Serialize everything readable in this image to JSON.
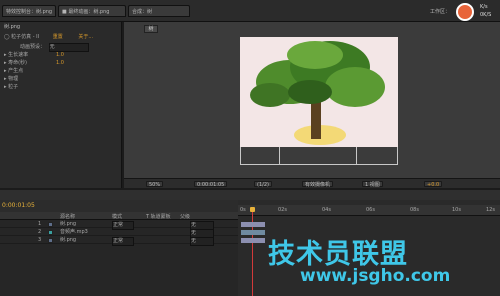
{
  "header": {
    "tab_effects": "特效控制台：树.png",
    "tab_source": "■ 最终动画：树.png",
    "tab_comp": "合成：树",
    "workspace_label": "工作区：",
    "comp_tab": "树",
    "right_fragments": [
      "K/s",
      "0K/S"
    ]
  },
  "left_panel": {
    "title": "树.png",
    "layer_name": "◯ 粒子仿真 - II",
    "reset": "重置",
    "about": "关于...",
    "preset_label": "动画预设：",
    "preset_value": "无",
    "rows": [
      {
        "label": "▸ 生长速率",
        "value": "1.0"
      },
      {
        "label": "▸ 寿命(秒)",
        "value": "1.0"
      },
      {
        "label": "▸ 产生点",
        "value": ""
      },
      {
        "label": "▸ 物理",
        "value": ""
      },
      {
        "label": "▸ 粒子",
        "value": ""
      }
    ]
  },
  "viewer_toolbar": {
    "zoom": "50%",
    "timecode": "0:00:01:05",
    "quality": "(1/2)",
    "camera": "有效摄像机",
    "views": "1 视图",
    "offset": "+0.0"
  },
  "timeline": {
    "timecode": "0:00:01:05",
    "columns": {
      "source": "源名称",
      "mode": "模式",
      "trkmat": "T 轨道蒙板",
      "parent": "父级"
    },
    "layers": [
      {
        "num": "1",
        "name": "树.png",
        "mode": "正常",
        "parent": "无"
      },
      {
        "num": "2",
        "name": "音频声.mp3",
        "mode": "",
        "parent": "无"
      },
      {
        "num": "3",
        "name": "树.png",
        "mode": "正常",
        "parent": "无"
      }
    ],
    "ruler_ticks": [
      "0s",
      "02s",
      "04s",
      "06s",
      "08s",
      "10s",
      "12s"
    ]
  },
  "watermark": {
    "line1": "技术员联盟",
    "line2": "www.jsgho.com"
  },
  "colors": {
    "watermark": "#3fc7e8",
    "playhead": "#e8b23a",
    "layer_bar": "#8c8fb0",
    "canvas_bg": "#f3e6e6"
  }
}
